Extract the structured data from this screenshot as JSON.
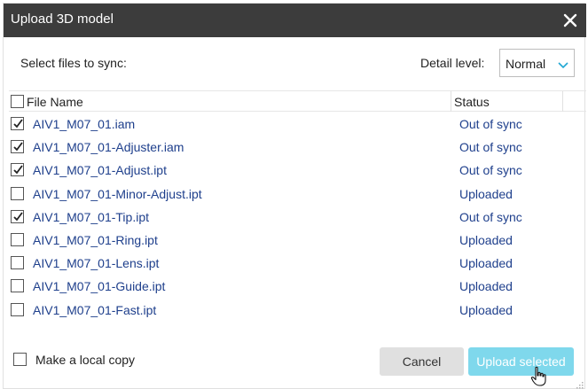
{
  "dialog": {
    "title": "Upload 3D model",
    "close_icon": "close-icon"
  },
  "header": {
    "select_label": "Select files to sync:",
    "detail_label": "Detail level:",
    "detail_value": "Normal",
    "detail_icon": "chevron-down-icon"
  },
  "table": {
    "columns": {
      "name": "File Name",
      "status": "Status"
    },
    "select_all_checked": false,
    "rows": [
      {
        "name": "AIV1_M07_01.iam",
        "status": "Out of sync",
        "checked": true
      },
      {
        "name": "AIV1_M07_01-Adjuster.iam",
        "status": "Out of sync",
        "checked": true
      },
      {
        "name": "AIV1_M07_01-Adjust.ipt",
        "status": "Out of sync",
        "checked": true
      },
      {
        "name": "AIV1_M07_01-Minor-Adjust.ipt",
        "status": "Uploaded",
        "checked": false
      },
      {
        "name": "AIV1_M07_01-Tip.ipt",
        "status": "Out of sync",
        "checked": true
      },
      {
        "name": "AIV1_M07_01-Ring.ipt",
        "status": "Uploaded",
        "checked": false
      },
      {
        "name": "AIV1_M07_01-Lens.ipt",
        "status": "Uploaded",
        "checked": false
      },
      {
        "name": "AIV1_M07_01-Guide.ipt",
        "status": "Uploaded",
        "checked": false
      },
      {
        "name": "AIV1_M07_01-Fast.ipt",
        "status": "Uploaded",
        "checked": false
      }
    ]
  },
  "footer": {
    "local_copy_label": "Make a local copy",
    "local_copy_checked": false,
    "cancel_label": "Cancel",
    "upload_label": "Upload selected"
  },
  "colors": {
    "titlebar": "#3c3c3c",
    "link_text": "#1e3f8c",
    "accent_chevron": "#1fa7d3",
    "upload_button": "#7fd8ec",
    "cancel_button": "#e0e0e0"
  }
}
